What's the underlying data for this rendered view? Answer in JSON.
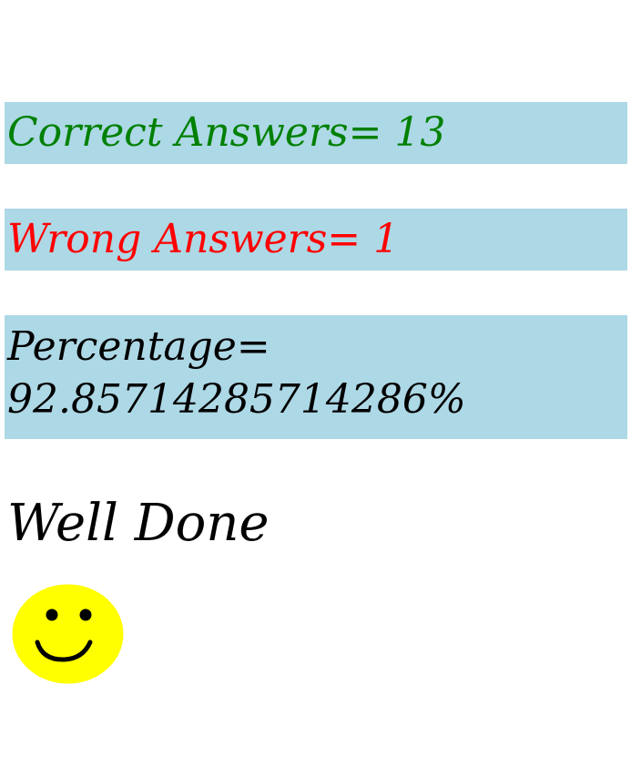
{
  "results": {
    "correct_label": "Correct Answers= 13",
    "wrong_label": "Wrong Answers= 1",
    "percentage_label": "Percentage=",
    "percentage_value": "92.857142857142​86%"
  },
  "message": {
    "text": "Well Done",
    "icon": "smiley-face-icon"
  },
  "colors": {
    "box_background": "#add8e6",
    "correct_text": "#008000",
    "wrong_text": "#ff0000",
    "smiley_face": "#ffff00"
  }
}
